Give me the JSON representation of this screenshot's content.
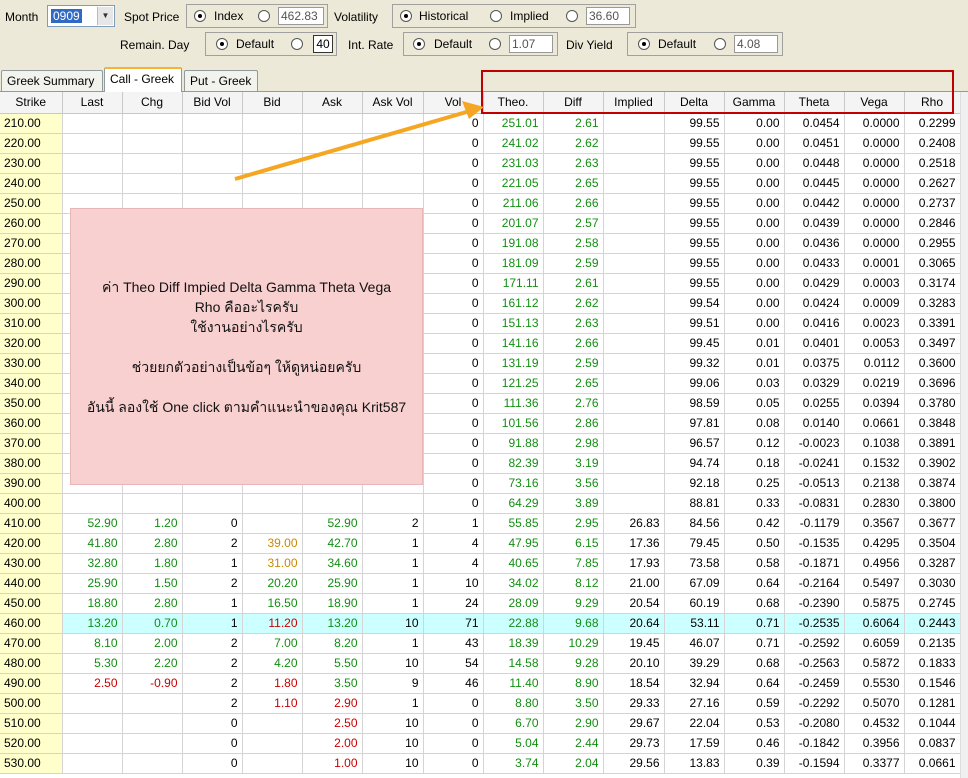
{
  "toolbar": {
    "month_label": "Month",
    "month_value": "0909",
    "spot_price_label": "Spot Price",
    "index_label": "Index",
    "index_value": "462.83",
    "volatility_label": "Volatility",
    "historical_label": "Historical",
    "implied_label": "Implied",
    "vol_value": "36.60",
    "remain_day_label": "Remain. Day",
    "remain_default_label": "Default",
    "remain_value": "40",
    "int_rate_label": "Int. Rate",
    "int_default_label": "Default",
    "int_value": "1.07",
    "div_yield_label": "Div Yield",
    "div_default_label": "Default",
    "div_value": "4.08"
  },
  "tabs": [
    {
      "label": "Greek Summary"
    },
    {
      "label": "Call - Greek"
    },
    {
      "label": "Put - Greek"
    }
  ],
  "table": {
    "columns": [
      "Strike",
      "Last",
      "Chg",
      "Bid Vol",
      "Bid",
      "Ask",
      "Ask Vol",
      "Vol",
      "Theo.",
      "Diff",
      "Implied",
      "Delta",
      "Gamma",
      "Theta",
      "Vega",
      "Rho"
    ],
    "rows": [
      [
        "210.00",
        "",
        "",
        "",
        "",
        "",
        "",
        "0",
        "251.01",
        "2.61",
        "",
        "99.55",
        "0.00",
        "0.0454",
        "0.0000",
        "0.2299"
      ],
      [
        "220.00",
        "",
        "",
        "",
        "",
        "",
        "",
        "0",
        "241.02",
        "2.62",
        "",
        "99.55",
        "0.00",
        "0.0451",
        "0.0000",
        "0.2408"
      ],
      [
        "230.00",
        "",
        "",
        "",
        "",
        "",
        "",
        "0",
        "231.03",
        "2.63",
        "",
        "99.55",
        "0.00",
        "0.0448",
        "0.0000",
        "0.2518"
      ],
      [
        "240.00",
        "",
        "",
        "",
        "",
        "",
        "",
        "0",
        "221.05",
        "2.65",
        "",
        "99.55",
        "0.00",
        "0.0445",
        "0.0000",
        "0.2627"
      ],
      [
        "250.00",
        "",
        "",
        "",
        "",
        "",
        "",
        "0",
        "211.06",
        "2.66",
        "",
        "99.55",
        "0.00",
        "0.0442",
        "0.0000",
        "0.2737"
      ],
      [
        "260.00",
        "",
        "",
        "",
        "",
        "",
        "",
        "0",
        "201.07",
        "2.57",
        "",
        "99.55",
        "0.00",
        "0.0439",
        "0.0000",
        "0.2846"
      ],
      [
        "270.00",
        "",
        "",
        "",
        "",
        "",
        "",
        "0",
        "191.08",
        "2.58",
        "",
        "99.55",
        "0.00",
        "0.0436",
        "0.0000",
        "0.2955"
      ],
      [
        "280.00",
        "",
        "",
        "",
        "",
        "",
        "",
        "0",
        "181.09",
        "2.59",
        "",
        "99.55",
        "0.00",
        "0.0433",
        "0.0001",
        "0.3065"
      ],
      [
        "290.00",
        "",
        "",
        "",
        "",
        "",
        "",
        "0",
        "171.11",
        "2.61",
        "",
        "99.55",
        "0.00",
        "0.0429",
        "0.0003",
        "0.3174"
      ],
      [
        "300.00",
        "",
        "",
        "",
        "",
        "",
        "",
        "0",
        "161.12",
        "2.62",
        "",
        "99.54",
        "0.00",
        "0.0424",
        "0.0009",
        "0.3283"
      ],
      [
        "310.00",
        "",
        "",
        "",
        "",
        "",
        "",
        "0",
        "151.13",
        "2.63",
        "",
        "99.51",
        "0.00",
        "0.0416",
        "0.0023",
        "0.3391"
      ],
      [
        "320.00",
        "",
        "",
        "",
        "",
        "",
        "",
        "0",
        "141.16",
        "2.66",
        "",
        "99.45",
        "0.01",
        "0.0401",
        "0.0053",
        "0.3497"
      ],
      [
        "330.00",
        "",
        "",
        "",
        "",
        "",
        "",
        "0",
        "131.19",
        "2.59",
        "",
        "99.32",
        "0.01",
        "0.0375",
        "0.0112",
        "0.3600"
      ],
      [
        "340.00",
        "",
        "",
        "",
        "",
        "",
        "",
        "0",
        "121.25",
        "2.65",
        "",
        "99.06",
        "0.03",
        "0.0329",
        "0.0219",
        "0.3696"
      ],
      [
        "350.00",
        "",
        "",
        "",
        "",
        "",
        "",
        "0",
        "111.36",
        "2.76",
        "",
        "98.59",
        "0.05",
        "0.0255",
        "0.0394",
        "0.3780"
      ],
      [
        "360.00",
        "",
        "",
        "",
        "",
        "",
        "",
        "0",
        "101.56",
        "2.86",
        "",
        "97.81",
        "0.08",
        "0.0140",
        "0.0661",
        "0.3848"
      ],
      [
        "370.00",
        "",
        "",
        "",
        "",
        "",
        "",
        "0",
        "91.88",
        "2.98",
        "",
        "96.57",
        "0.12",
        "-0.0023",
        "0.1038",
        "0.3891"
      ],
      [
        "380.00",
        "",
        "",
        "",
        "",
        "",
        "",
        "0",
        "82.39",
        "3.19",
        "",
        "94.74",
        "0.18",
        "-0.0241",
        "0.1532",
        "0.3902"
      ],
      [
        "390.00",
        "",
        "",
        "",
        "",
        "",
        "",
        "0",
        "73.16",
        "3.56",
        "",
        "92.18",
        "0.25",
        "-0.0513",
        "0.2138",
        "0.3874"
      ],
      [
        "400.00",
        "",
        "",
        "",
        "",
        "",
        "",
        "0",
        "64.29",
        "3.89",
        "",
        "88.81",
        "0.33",
        "-0.0831",
        "0.2830",
        "0.3800"
      ],
      [
        "410.00",
        "52.90",
        "1.20",
        "0",
        "",
        "52.90",
        "2",
        "1",
        "55.85",
        "2.95",
        "26.83",
        "84.56",
        "0.42",
        "-0.1179",
        "0.3567",
        "0.3677"
      ],
      [
        "420.00",
        "41.80",
        "2.80",
        "2",
        "39.00",
        "42.70",
        "1",
        "4",
        "47.95",
        "6.15",
        "17.36",
        "79.45",
        "0.50",
        "-0.1535",
        "0.4295",
        "0.3504"
      ],
      [
        "430.00",
        "32.80",
        "1.80",
        "1",
        "31.00",
        "34.60",
        "1",
        "4",
        "40.65",
        "7.85",
        "17.93",
        "73.58",
        "0.58",
        "-0.1871",
        "0.4956",
        "0.3287"
      ],
      [
        "440.00",
        "25.90",
        "1.50",
        "2",
        "20.20",
        "25.90",
        "1",
        "10",
        "34.02",
        "8.12",
        "21.00",
        "67.09",
        "0.64",
        "-0.2164",
        "0.5497",
        "0.3030"
      ],
      [
        "450.00",
        "18.80",
        "2.80",
        "1",
        "16.50",
        "18.90",
        "1",
        "24",
        "28.09",
        "9.29",
        "20.54",
        "60.19",
        "0.68",
        "-0.2390",
        "0.5875",
        "0.2745"
      ],
      [
        "460.00",
        "13.20",
        "0.70",
        "1",
        "11.20",
        "13.20",
        "10",
        "71",
        "22.88",
        "9.68",
        "20.64",
        "53.11",
        "0.71",
        "-0.2535",
        "0.6064",
        "0.2443"
      ],
      [
        "470.00",
        "8.10",
        "2.00",
        "2",
        "7.00",
        "8.20",
        "1",
        "43",
        "18.39",
        "10.29",
        "19.45",
        "46.07",
        "0.71",
        "-0.2592",
        "0.6059",
        "0.2135"
      ],
      [
        "480.00",
        "5.30",
        "2.20",
        "2",
        "4.20",
        "5.50",
        "10",
        "54",
        "14.58",
        "9.28",
        "20.10",
        "39.29",
        "0.68",
        "-0.2563",
        "0.5872",
        "0.1833"
      ],
      [
        "490.00",
        "2.50",
        "-0.90",
        "2",
        "1.80",
        "3.50",
        "9",
        "46",
        "11.40",
        "8.90",
        "18.54",
        "32.94",
        "0.64",
        "-0.2459",
        "0.5530",
        "0.1546"
      ],
      [
        "500.00",
        "",
        "",
        "2",
        "1.10",
        "2.90",
        "1",
        "0",
        "8.80",
        "3.50",
        "29.33",
        "27.16",
        "0.59",
        "-0.2292",
        "0.5070",
        "0.1281"
      ],
      [
        "510.00",
        "",
        "",
        "0",
        "",
        "2.50",
        "10",
        "0",
        "6.70",
        "2.90",
        "29.67",
        "22.04",
        "0.53",
        "-0.2080",
        "0.4532",
        "0.1044"
      ],
      [
        "520.00",
        "",
        "",
        "0",
        "",
        "2.00",
        "10",
        "0",
        "5.04",
        "2.44",
        "29.73",
        "17.59",
        "0.46",
        "-0.1842",
        "0.3956",
        "0.0837"
      ],
      [
        "530.00",
        "",
        "",
        "0",
        "",
        "1.00",
        "10",
        "0",
        "3.74",
        "2.04",
        "29.56",
        "13.83",
        "0.39",
        "-0.1594",
        "0.3377",
        "0.0661"
      ]
    ],
    "highlight_row": 25,
    "colors": {
      "up": "#128e12",
      "down": "#cc0000",
      "bid": "#cc8800",
      "strike_bg": "#ffffcc",
      "highlight_bg": "#ccffff"
    }
  },
  "note": {
    "lines": [
      "ค่า Theo Diff Impied Delta Gamma Theta Vega",
      "Rho คืออะไรครับ",
      "ใช้งานอย่างไรครับ",
      "",
      "ช่วยยกตัวอย่างเป็นข้อๆ  ให้ดูหน่อยครับ",
      "",
      "อันนี้ ลองใช้ One click ตามคำแนะนำของคุณ Krit587"
    ]
  }
}
